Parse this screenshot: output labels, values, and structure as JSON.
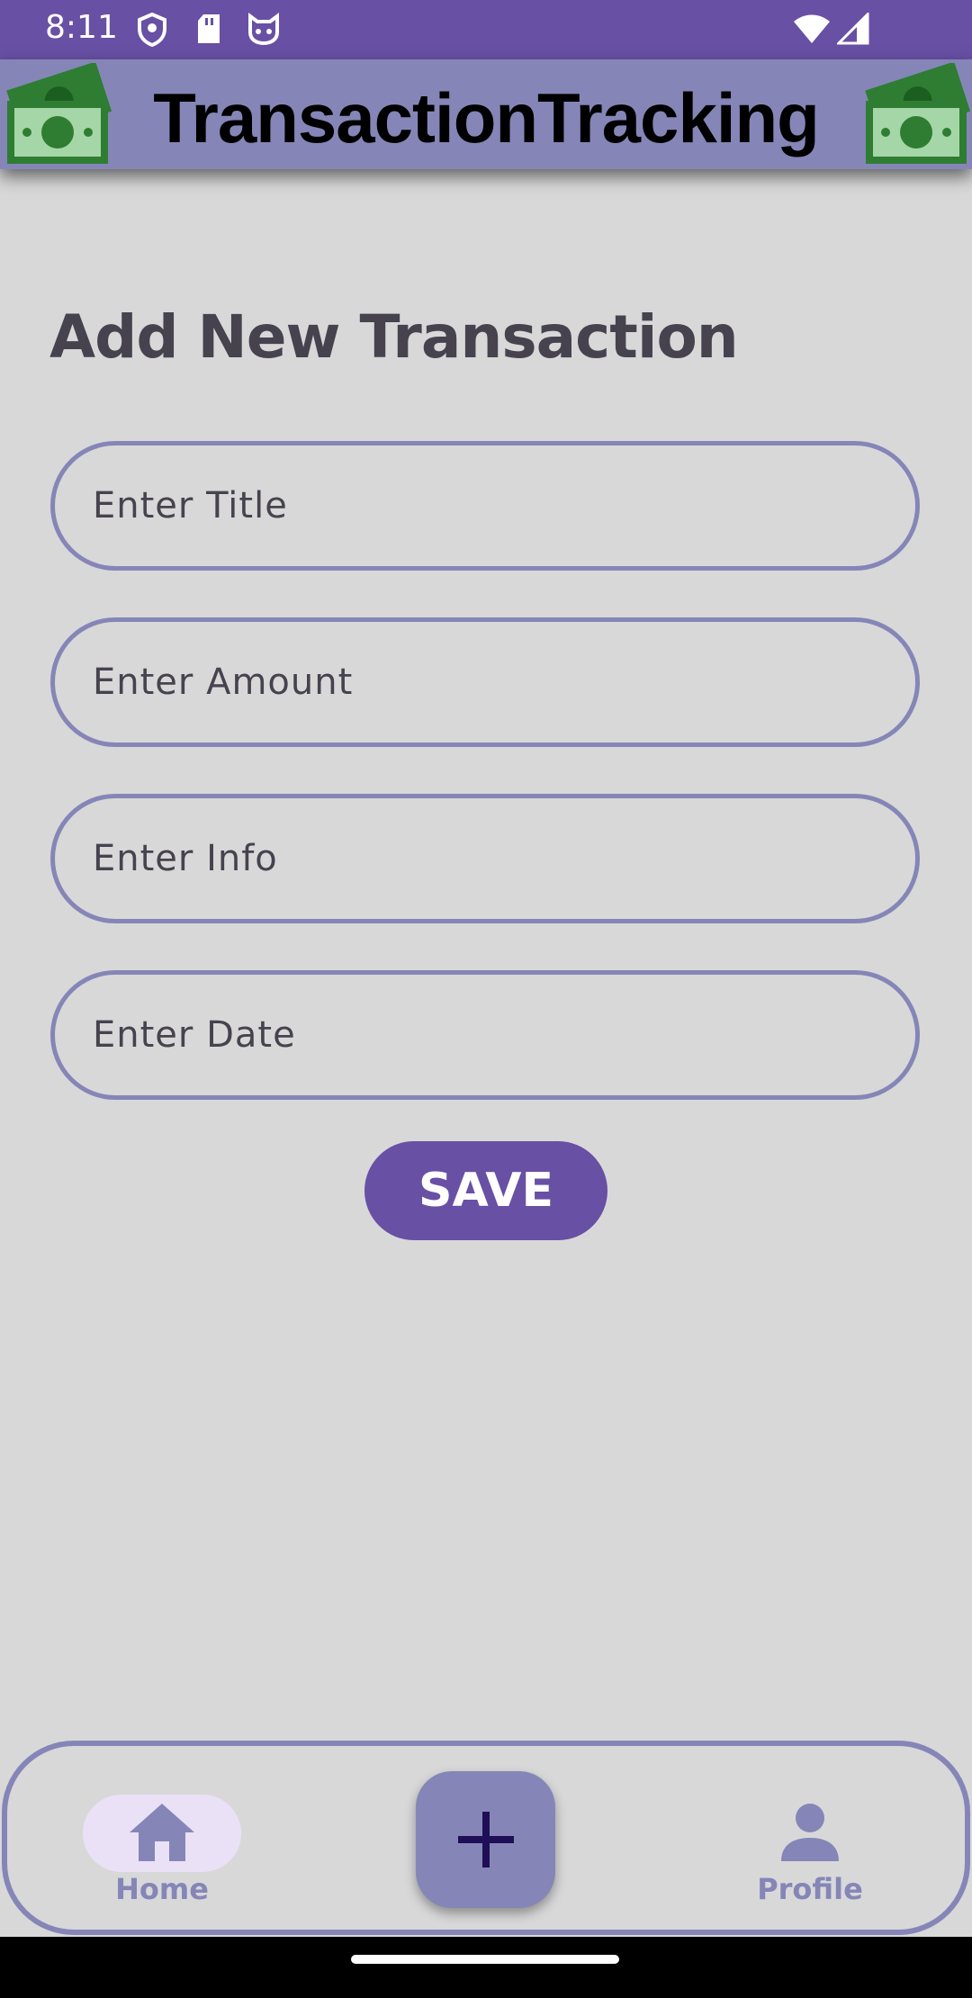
{
  "status_bar": {
    "time": "8:11",
    "left_icons": [
      "shield-icon",
      "sd-card-icon",
      "cat-face-icon"
    ],
    "right_icons": [
      "wifi-icon",
      "cell-signal-icon"
    ]
  },
  "app_bar": {
    "title": "TransactionTracking",
    "icons": [
      "money-icon",
      "money-icon"
    ],
    "background": "#8586b7"
  },
  "form": {
    "heading": "Add New Transaction",
    "fields": [
      {
        "name": "title",
        "placeholder": "Enter Title",
        "value": ""
      },
      {
        "name": "amount",
        "placeholder": "Enter Amount",
        "value": ""
      },
      {
        "name": "info",
        "placeholder": "Enter Info",
        "value": ""
      },
      {
        "name": "date",
        "placeholder": "Enter Date",
        "value": ""
      }
    ],
    "save_label": "SAVE"
  },
  "bottom_nav": {
    "items": [
      {
        "label": "Home",
        "icon": "home-icon",
        "selected": true
      },
      {
        "label": "Profile",
        "icon": "person-icon",
        "selected": false
      }
    ],
    "fab_icon": "plus-icon"
  },
  "colors": {
    "primary": "#6850a5",
    "accent": "#8586b7",
    "background": "#d8d8d9",
    "selected_pill": "#ebe1f7"
  }
}
